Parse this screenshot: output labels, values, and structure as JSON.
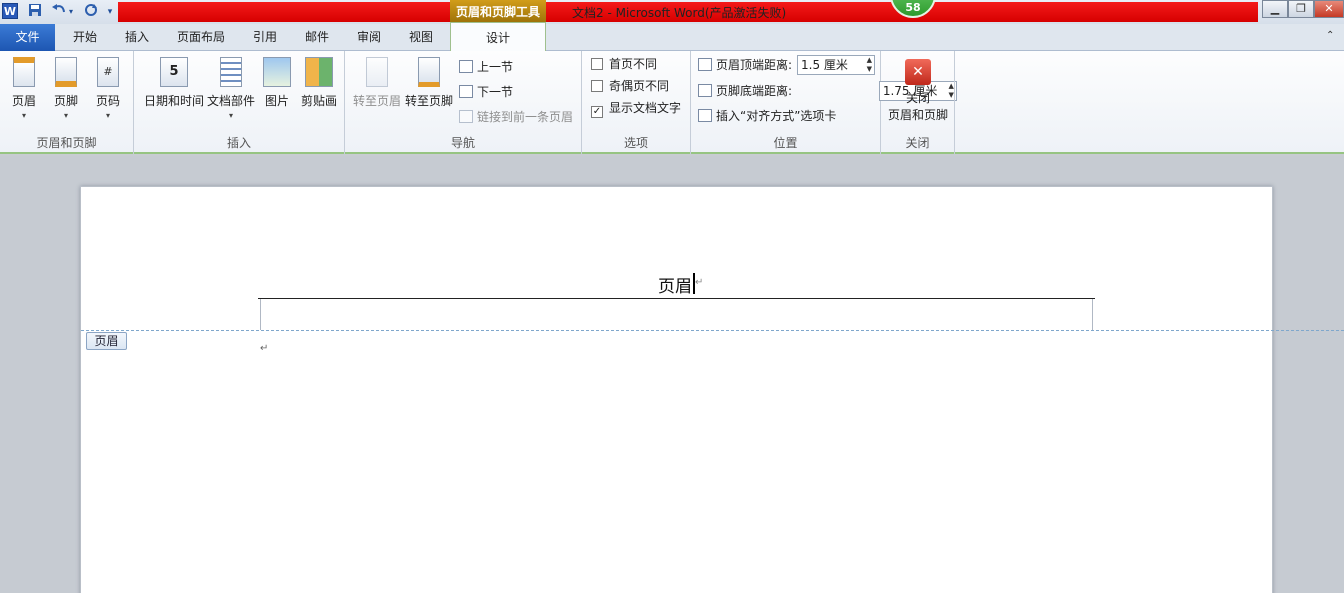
{
  "titlebar": {
    "app_icon": "W",
    "contextual_tab": "页眉和页脚工具",
    "window_title": "文档2 - Microsoft Word(产品激活失败)",
    "badge": "58",
    "icons": [
      "word-icon",
      "save-icon",
      "undo-icon",
      "redo-icon",
      "customize-icon"
    ]
  },
  "tabs": {
    "file": "文件",
    "home": "开始",
    "insert": "插入",
    "layout": "页面布局",
    "references": "引用",
    "mailings": "邮件",
    "review": "审阅",
    "view": "视图",
    "design": "设计"
  },
  "ribbon": {
    "group1": {
      "label": "页眉和页脚",
      "header": "页眉",
      "footer": "页脚",
      "page_number": "页码"
    },
    "group2": {
      "label": "插入",
      "datetime": "日期和时间",
      "quickparts": "文档部件",
      "picture": "图片",
      "clipart": "剪贴画"
    },
    "group3": {
      "label": "导航",
      "goto_header": "转至页眉",
      "goto_footer": "转至页脚",
      "prev": "上一节",
      "next": "下一节",
      "link_prev": "链接到前一条页眉"
    },
    "group4": {
      "label": "选项",
      "diff_first": "首页不同",
      "diff_odd_even": "奇偶页不同",
      "show_doc_text": "显示文档文字",
      "show_doc_text_checked": "✓"
    },
    "group5": {
      "label": "位置",
      "header_top": "页眉顶端距离:",
      "header_top_value": "1.5 厘米",
      "footer_bottom": "页脚底端距离:",
      "footer_bottom_value": "1.75 厘米",
      "insert_align_tab": "插入“对齐方式”选项卡"
    },
    "group6": {
      "label": "关闭",
      "close_line1": "关闭",
      "close_line2": "页眉和页脚"
    }
  },
  "document": {
    "header_text": "页眉",
    "header_tag": "页眉",
    "para_mark": "↵"
  },
  "colors": {
    "accent": "#1d56b2",
    "context": "#c0900f",
    "titlebar_red": "#e00000"
  }
}
